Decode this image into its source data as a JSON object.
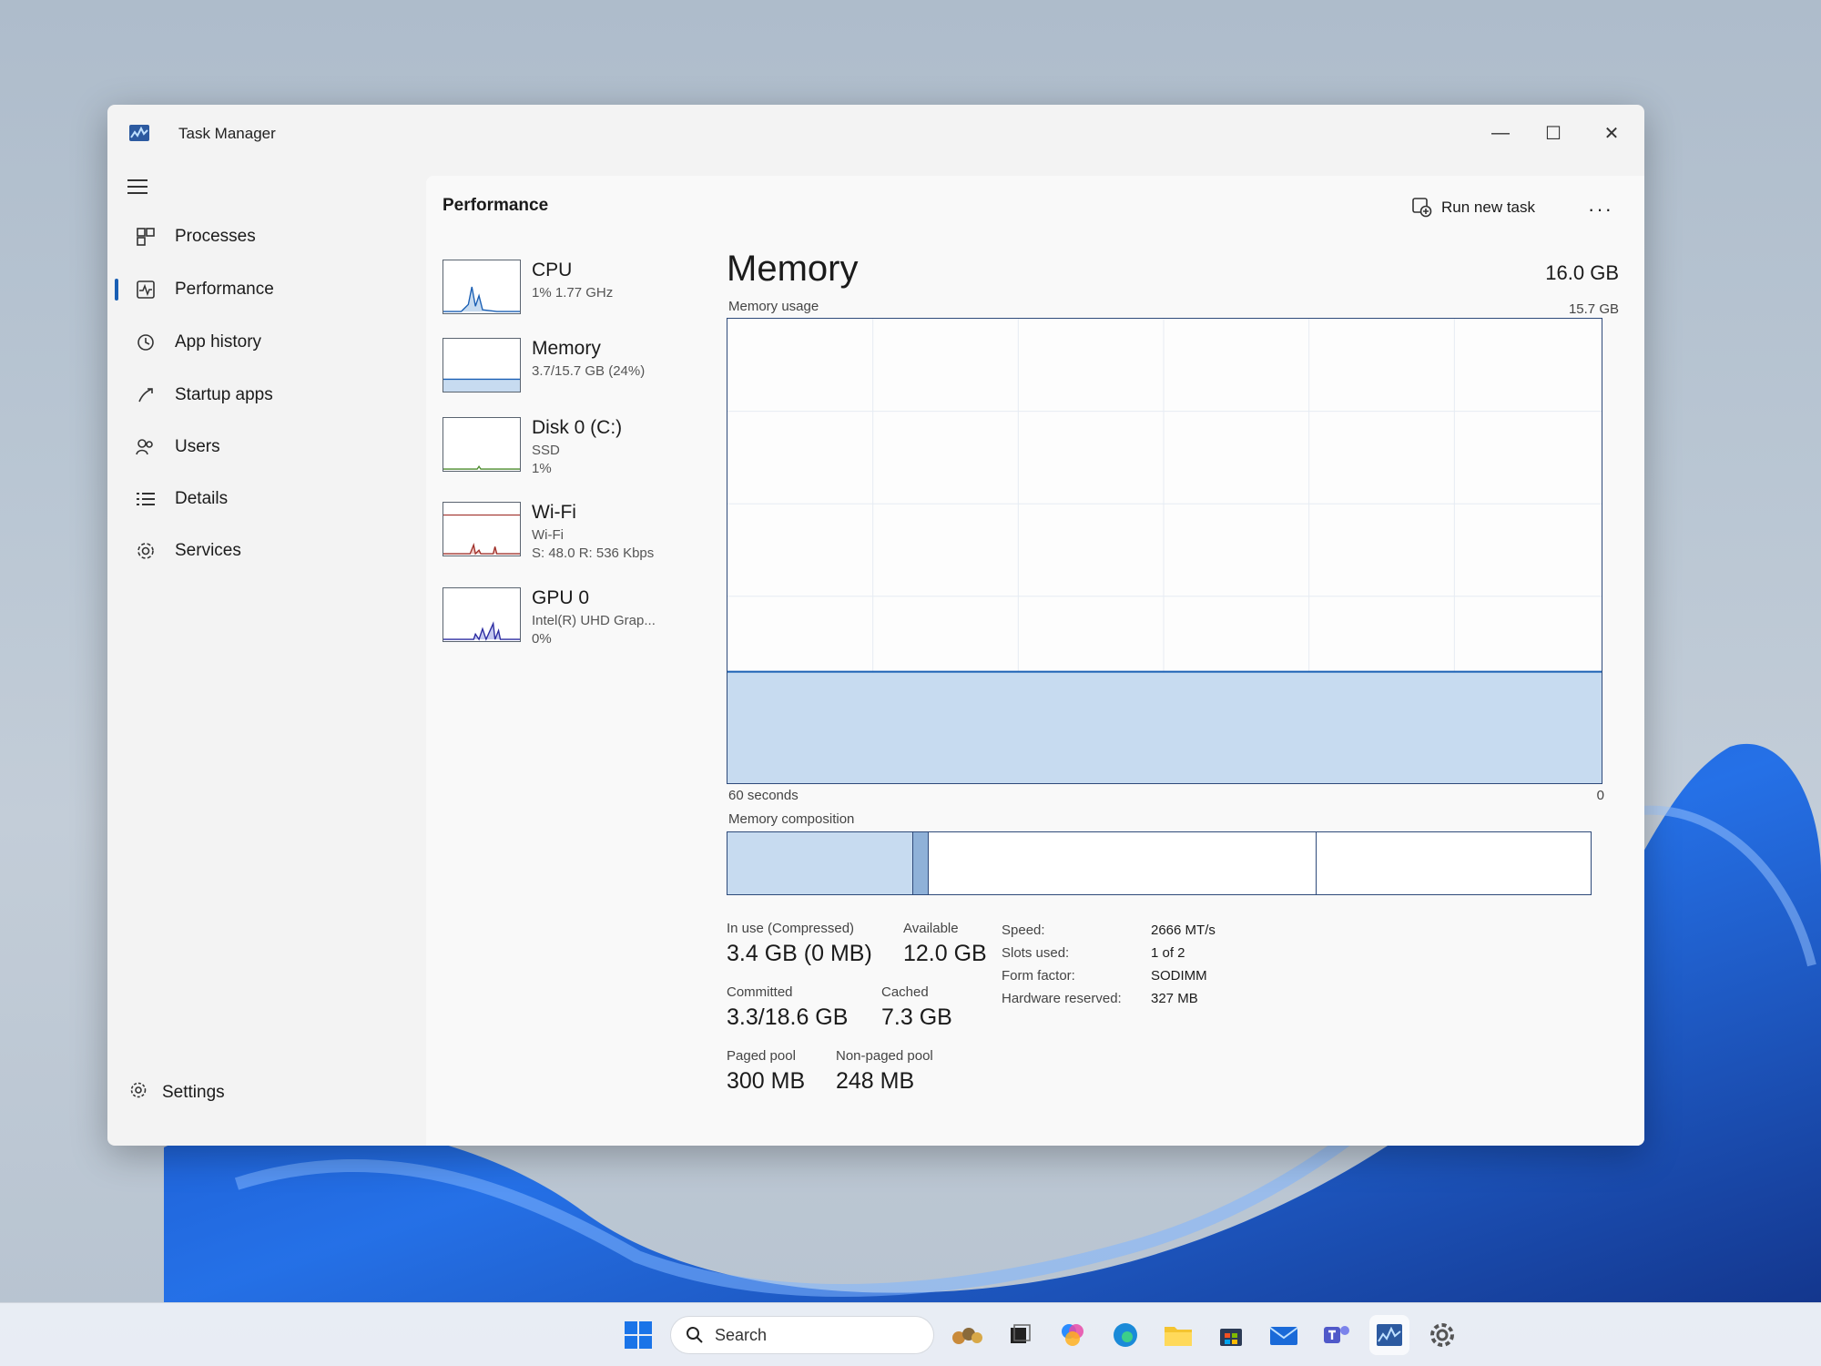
{
  "window": {
    "title": "Task Manager",
    "controls": {
      "minimize": "—",
      "maximize": "☐",
      "close": "✕"
    }
  },
  "sidebar": {
    "items": [
      {
        "label": "Processes",
        "icon": "processes-icon"
      },
      {
        "label": "Performance",
        "icon": "performance-icon",
        "active": true
      },
      {
        "label": "App history",
        "icon": "history-icon"
      },
      {
        "label": "Startup apps",
        "icon": "startup-icon"
      },
      {
        "label": "Users",
        "icon": "users-icon"
      },
      {
        "label": "Details",
        "icon": "details-icon"
      },
      {
        "label": "Services",
        "icon": "services-icon"
      }
    ],
    "settings": "Settings"
  },
  "header": {
    "page_title": "Performance",
    "run_new_task": "Run new task",
    "more": "···"
  },
  "resources": [
    {
      "name": "CPU",
      "sub1": "1% 1.77 GHz",
      "sub2": "",
      "sub3": ""
    },
    {
      "name": "Memory",
      "sub1": "3.7/15.7 GB (24%)",
      "sub2": "",
      "sub3": ""
    },
    {
      "name": "Disk 0 (C:)",
      "sub1": "SSD",
      "sub2": "1%",
      "sub3": ""
    },
    {
      "name": "Wi-Fi",
      "sub1": "Wi-Fi",
      "sub2": "S: 48.0 R: 536 Kbps",
      "sub3": ""
    },
    {
      "name": "GPU 0",
      "sub1": "Intel(R) UHD Grap...",
      "sub2": "0%",
      "sub3": ""
    }
  ],
  "detail": {
    "title": "Memory",
    "total": "16.0 GB",
    "usage_label": "Memory usage",
    "usage_max": "15.7 GB",
    "usage_fraction": 0.24,
    "axis_left": "60 seconds",
    "axis_right": "0",
    "composition_label": "Memory composition",
    "composition": [
      {
        "name": "in-use",
        "fraction": 0.215,
        "color": "#c7dbf0"
      },
      {
        "name": "modified",
        "fraction": 0.018,
        "color": "#8fb1d8"
      },
      {
        "name": "standby",
        "fraction": 0.45,
        "color": "#ffffff"
      },
      {
        "name": "free",
        "fraction": 0.317,
        "color": "#ffffff"
      }
    ],
    "stats": {
      "in_use_label": "In use (Compressed)",
      "in_use_value": "3.4 GB (0 MB)",
      "available_label": "Available",
      "available_value": "12.0 GB",
      "committed_label": "Committed",
      "committed_value": "3.3/18.6 GB",
      "cached_label": "Cached",
      "cached_value": "7.3 GB",
      "paged_label": "Paged pool",
      "paged_value": "300 MB",
      "nonpaged_label": "Non-paged pool",
      "nonpaged_value": "248 MB"
    },
    "specs": [
      {
        "key": "Speed:",
        "value": "2666 MT/s"
      },
      {
        "key": "Slots used:",
        "value": "1 of 2"
      },
      {
        "key": "Form factor:",
        "value": "SODIMM"
      },
      {
        "key": "Hardware reserved:",
        "value": "327 MB"
      }
    ]
  },
  "taskbar": {
    "search_placeholder": "Search",
    "apps": [
      "widgets-icon",
      "task-view-icon",
      "copilot-icon",
      "edge-icon",
      "file-explorer-icon",
      "store-icon",
      "mail-icon",
      "teams-icon",
      "task-manager-icon",
      "settings-icon"
    ]
  },
  "colors": {
    "accent": "#1a5fb4",
    "memory_fill": "#c7dbf0",
    "graph_border": "#2e4a7a"
  }
}
